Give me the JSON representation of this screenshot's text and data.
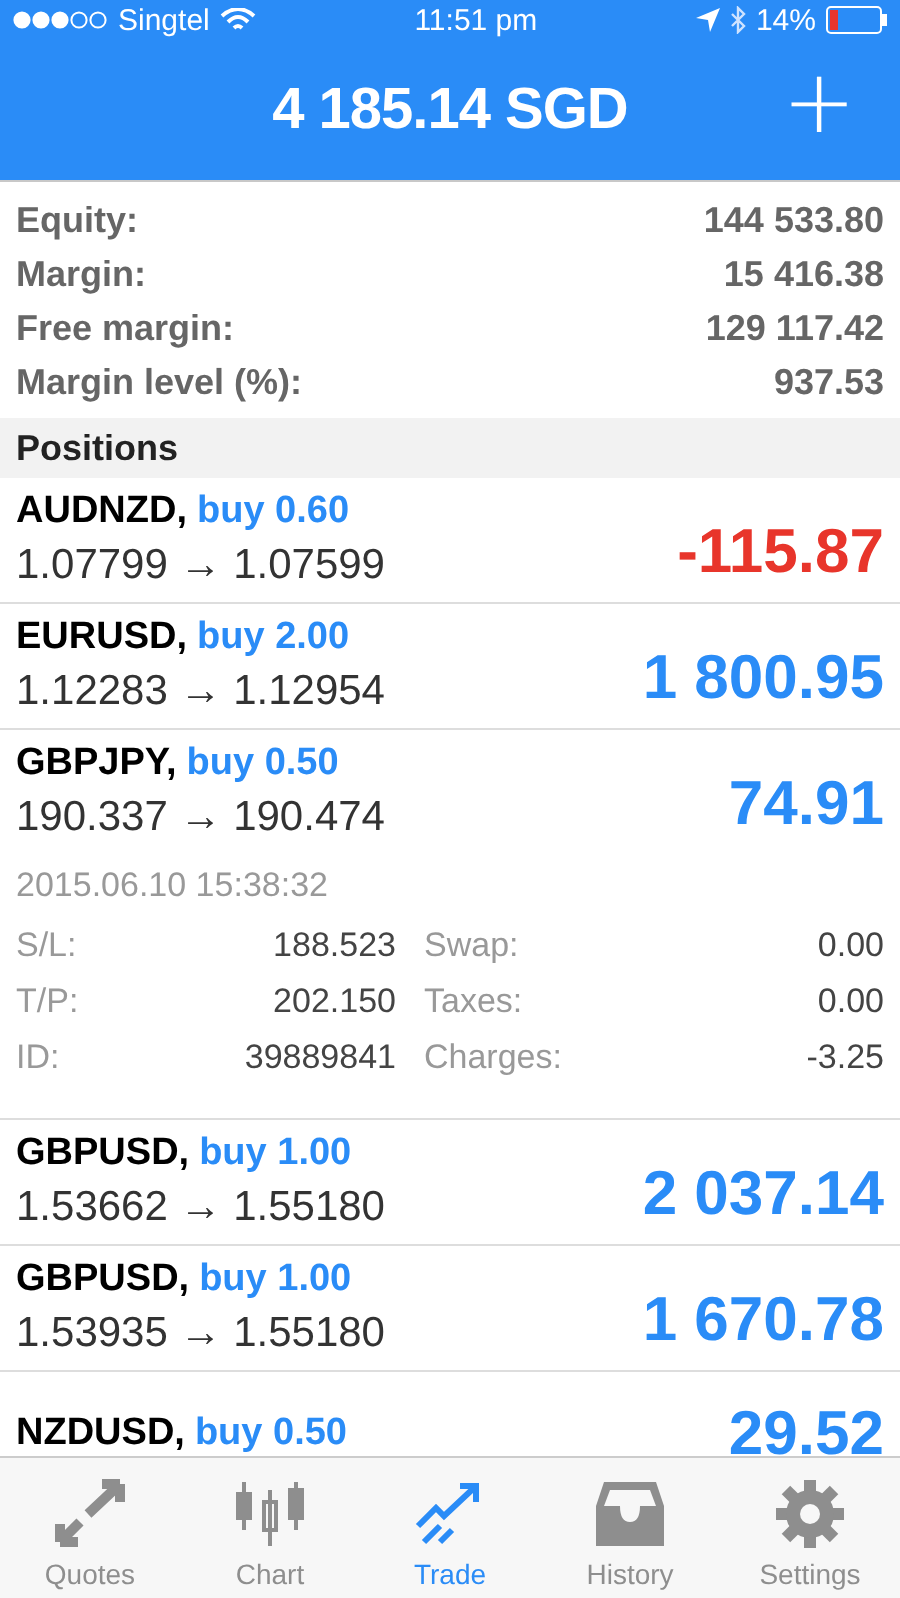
{
  "status_bar": {
    "carrier": "Singtel",
    "time": "11:51 pm",
    "battery": "14%"
  },
  "header": {
    "title": "4 185.14 SGD",
    "add_button": "+"
  },
  "summary": [
    {
      "label": "Equity:",
      "value": "144 533.80"
    },
    {
      "label": "Margin:",
      "value": "15 416.38"
    },
    {
      "label": "Free margin:",
      "value": "129 117.42"
    },
    {
      "label": "Margin level (%):",
      "value": "937.53"
    }
  ],
  "positions_heading": "Positions",
  "positions": [
    {
      "symbol": "AUDNZD,",
      "side": "buy 0.60",
      "prices": "1.07799 → 1.07599",
      "profit": "-115.87",
      "negative": true,
      "expanded": false
    },
    {
      "symbol": "EURUSD,",
      "side": "buy 2.00",
      "prices": "1.12283 → 1.12954",
      "profit": "1 800.95",
      "negative": false,
      "expanded": false
    },
    {
      "symbol": "GBPJPY,",
      "side": "buy 0.50",
      "prices": "190.337 → 190.474",
      "profit": "74.91",
      "negative": false,
      "expanded": true,
      "opened": "2015.06.10 15:38:32",
      "details": [
        {
          "label": "S/L:",
          "value": "188.523",
          "label_2": "Swap:",
          "value_2": "0.00"
        },
        {
          "label": "T/P:",
          "value": "202.150",
          "label_2": "Taxes:",
          "value_2": "0.00"
        },
        {
          "label": "ID:",
          "value": "39889841",
          "label_2": "Charges:",
          "value_2": "-3.25"
        }
      ]
    },
    {
      "symbol": "GBPUSD,",
      "side": "buy 1.00",
      "prices": "1.53662 → 1.55180",
      "profit": "2 037.14",
      "negative": false,
      "expanded": false
    },
    {
      "symbol": "GBPUSD,",
      "side": "buy 1.00",
      "prices": "1.53935 → 1.55180",
      "profit": "1 670.78",
      "negative": false,
      "expanded": false
    },
    {
      "symbol": "NZDUSD,",
      "side": "buy 0.50",
      "profit": "29.52",
      "negative": false,
      "expanded": false
    }
  ],
  "tabs": [
    {
      "label": "Quotes",
      "kind": "quotes",
      "selected": false
    },
    {
      "label": "Chart",
      "kind": "chart",
      "selected": false
    },
    {
      "label": "Trade",
      "kind": "trade",
      "selected": true
    },
    {
      "label": "History",
      "kind": "history",
      "selected": false
    },
    {
      "label": "Settings",
      "kind": "settings",
      "selected": false
    }
  ]
}
